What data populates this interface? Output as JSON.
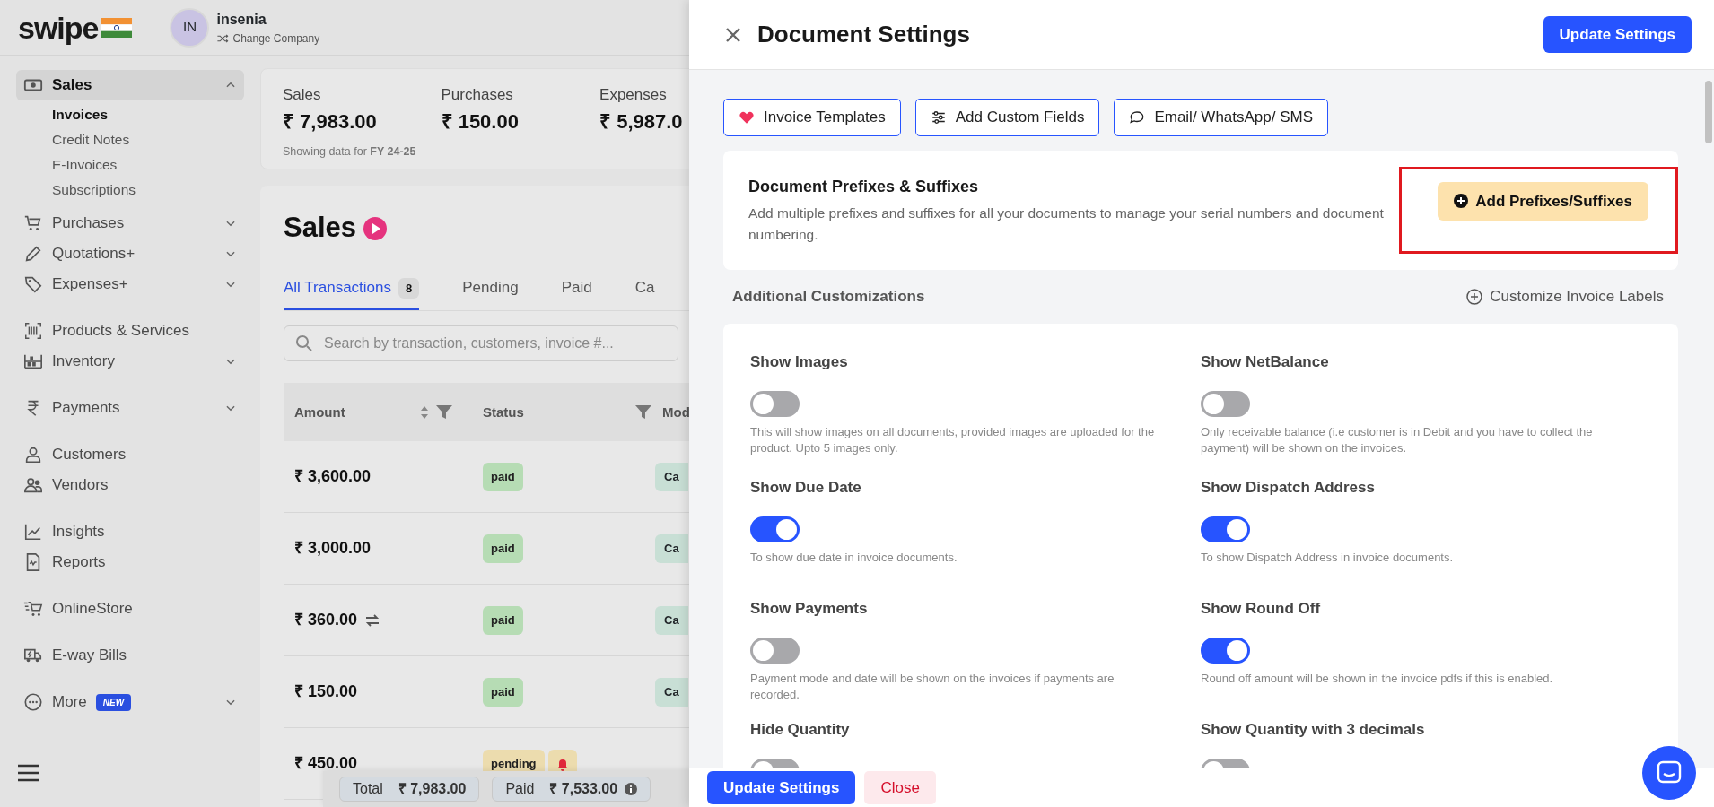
{
  "header": {
    "logo": "swipe",
    "avatar": "IN",
    "company": "insenia",
    "switch_label": "Change Company"
  },
  "sidebar": {
    "groups": [
      [
        {
          "label": "Sales",
          "selected": true,
          "expanded": true,
          "children": [
            {
              "label": "Invoices",
              "selected": true
            },
            {
              "label": "Credit Notes",
              "selected": false
            },
            {
              "label": "E-Invoices",
              "selected": false
            },
            {
              "label": "Subscriptions",
              "selected": false
            }
          ]
        },
        {
          "label": "Purchases",
          "selected": false,
          "expanded": false
        },
        {
          "label": "Quotations+",
          "selected": false,
          "expanded": false
        },
        {
          "label": "Expenses+",
          "selected": false,
          "expanded": false
        }
      ],
      [
        {
          "label": "Products & Services",
          "selected": false
        },
        {
          "label": "Inventory",
          "selected": false,
          "expanded": false
        }
      ],
      [
        {
          "label": "Payments",
          "selected": false,
          "expanded": false
        }
      ],
      [
        {
          "label": "Customers",
          "selected": false
        },
        {
          "label": "Vendors",
          "selected": false
        }
      ],
      [
        {
          "label": "Insights",
          "selected": false
        },
        {
          "label": "Reports",
          "selected": false
        }
      ],
      [
        {
          "label": "OnlineStore",
          "selected": false
        }
      ],
      [
        {
          "label": "E-way Bills",
          "selected": false
        }
      ],
      [
        {
          "label": "More",
          "selected": false,
          "expanded": false,
          "badge": "NEW"
        }
      ]
    ]
  },
  "stats": [
    {
      "label": "Sales",
      "value": "₹ 7,983.00"
    },
    {
      "label": "Purchases",
      "value": "₹ 150.00"
    },
    {
      "label": "Expenses",
      "value": "₹ 5,987.0"
    }
  ],
  "stats_note": "Showing data for **FY 24-25**",
  "page_title": "Sales",
  "tabs": [
    {
      "label": "All Transactions",
      "count": "8",
      "selected": true
    },
    {
      "label": "Pending",
      "selected": false
    },
    {
      "label": "Paid",
      "selected": false
    },
    {
      "label": "Ca",
      "selected": false
    }
  ],
  "search": {
    "placeholder": "Search by transaction, customers, invoice #..."
  },
  "table": {
    "columns": [
      "Amount",
      "Status",
      "Mod"
    ],
    "rows": [
      {
        "amount": "₹ 3,600.00",
        "recurring": false,
        "status": "paid",
        "color": "#b6dcb4",
        "reminder": false,
        "mode": "Ca"
      },
      {
        "amount": "₹ 3,000.00",
        "recurring": false,
        "status": "paid",
        "color": "#b6dcb4",
        "reminder": false,
        "mode": "Ca"
      },
      {
        "amount": "₹ 360.00",
        "recurring": true,
        "status": "paid",
        "color": "#b6dcb4",
        "reminder": false,
        "mode": "Ca"
      },
      {
        "amount": "₹ 150.00",
        "recurring": false,
        "status": "paid",
        "color": "#b6dcb4",
        "reminder": false,
        "mode": "Ca"
      },
      {
        "amount": "₹ 450.00",
        "recurring": false,
        "status": "pending",
        "color": "#ecdcae",
        "reminder": true
      }
    ]
  },
  "summary": [
    {
      "label": "Total",
      "value": "₹ 7,983.00",
      "info": false
    },
    {
      "label": "Paid",
      "value": "₹ 7,533.00",
      "info": true
    }
  ],
  "drawer": {
    "title": "Document Settings",
    "primary_button": "Update Settings",
    "quick_links": [
      {
        "label": "Invoice Templates"
      },
      {
        "label": "Add Custom Fields"
      },
      {
        "label": "Email/ WhatsApp/ SMS"
      }
    ],
    "prefix_card": {
      "title": "Document Prefixes & Suffixes",
      "text": "Add multiple prefixes and suffixes for all your documents to manage your serial numbers and document numbering.",
      "button": "Add Prefixes/Suffixes",
      "highlighted": true
    },
    "section_title": "Additional Customizations",
    "section_link": "Customize Invoice Labels",
    "settings": [
      {
        "label": "Show Images",
        "on": false,
        "hint": "This will show images on all documents, provided images are uploaded for the product. Upto 5 images only."
      },
      {
        "label": "Show NetBalance",
        "on": false,
        "hint": "Only receivable balance (i.e customer is in Debit and you have to collect the payment) will be shown on the invoices."
      },
      {
        "label": "Show Due Date",
        "on": true,
        "hint": "To show due date in invoice documents."
      },
      {
        "label": "Show Dispatch Address",
        "on": true,
        "hint": "To show Dispatch Address in invoice documents."
      },
      {
        "label": "Show Payments",
        "on": false,
        "hint": "Payment mode and date will be shown on the invoices if payments are recorded."
      },
      {
        "label": "Show Round Off",
        "on": true,
        "hint": "Round off amount will be shown in the invoice pdfs if this is enabled."
      },
      {
        "label": "Hide Quantity",
        "on": false
      },
      {
        "label": "Show Quantity with 3 decimals",
        "on": false
      }
    ],
    "footer_buttons": [
      {
        "label": "Update Settings",
        "kind": "primary"
      },
      {
        "label": "Close",
        "kind": "danger"
      }
    ]
  }
}
